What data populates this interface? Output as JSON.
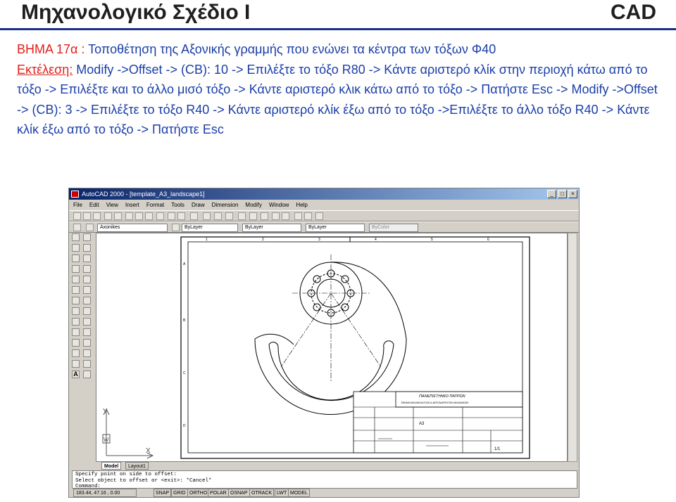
{
  "slide": {
    "title": "Μηχανολογικό Σχέδιο Ι",
    "tag": "CAD",
    "step_label": "ΒΗΜΑ 17α",
    "step_sep": " : ",
    "step_text": "Τοποθέτηση της Αξονικής γραμμής  που ενώνει τα κέντρα των τόξων Φ40",
    "exec_label": "Εκτέλεση:",
    "exec_text": " Modify ->Offset -> (CB): 10 -> Επιλέξτε το τόξο R80 -> Κάντε αριστερό κλίκ στην περιοχή κάτω από το τόξο -> Επιλέξτε και το άλλο μισό τόξο -> Κάντε αριστερό κλικ κάτω από το τόξο -> Πατήστε Esc -> Modify ->Offset -> (CB): 3 -> Επιλέξτε το τόξο R40 -> Κάντε αριστερό κλίκ έξω από το τόξο ->Επιλέξτε το άλλο τόξο R40 -> Κάντε κλίκ έξω από το τόξο -> Πατήστε Esc"
  },
  "autocad": {
    "title": "AutoCAD 2000 - [template_A3_landscape1]",
    "menu": [
      "File",
      "Edit",
      "View",
      "Insert",
      "Format",
      "Tools",
      "Draw",
      "Dimension",
      "Modify",
      "Window",
      "Help"
    ],
    "layer_combo": "Axonikes",
    "linetype_combo1": "ByLayer",
    "linetype_combo2": "ByLayer",
    "lineweight_combo": "ByLayer",
    "color_combo": "ByColor",
    "border_numbers": [
      "1",
      "2",
      "3",
      "4",
      "5",
      "6"
    ],
    "border_letters": [
      "A",
      "B",
      "C",
      "D"
    ],
    "titleblock_line1": "ΠΑΝΕΠΙΣΤΗΜΙΟ ΠΑΤΡΩΝ",
    "titleblock_line2": "ΤΜΗΜΑ ΜΗΧΑΝΟΛΟΓΩΝ & ΑΕΡΟΝΑΥΠΗΓΩΝ ΜΗΧΑΝΙΚΩΝ",
    "titleblock_size": "A3",
    "titleblock_scale": "1/1",
    "tabs": [
      "Model",
      "Layout1"
    ],
    "command_lines": [
      "Specify point on side to offset:",
      "Select object to offset or <exit>: *Cancel*",
      "Command:"
    ],
    "coords": "183.44, 47.16 , 0.00",
    "status_buttons": [
      "SNAP",
      "GRID",
      "ORTHO",
      "POLAR",
      "OSNAP",
      "OTRACK",
      "LWT",
      "MODEL"
    ],
    "ucs_x": "X",
    "ucs_y": "Y",
    "ucs_w": "W"
  }
}
